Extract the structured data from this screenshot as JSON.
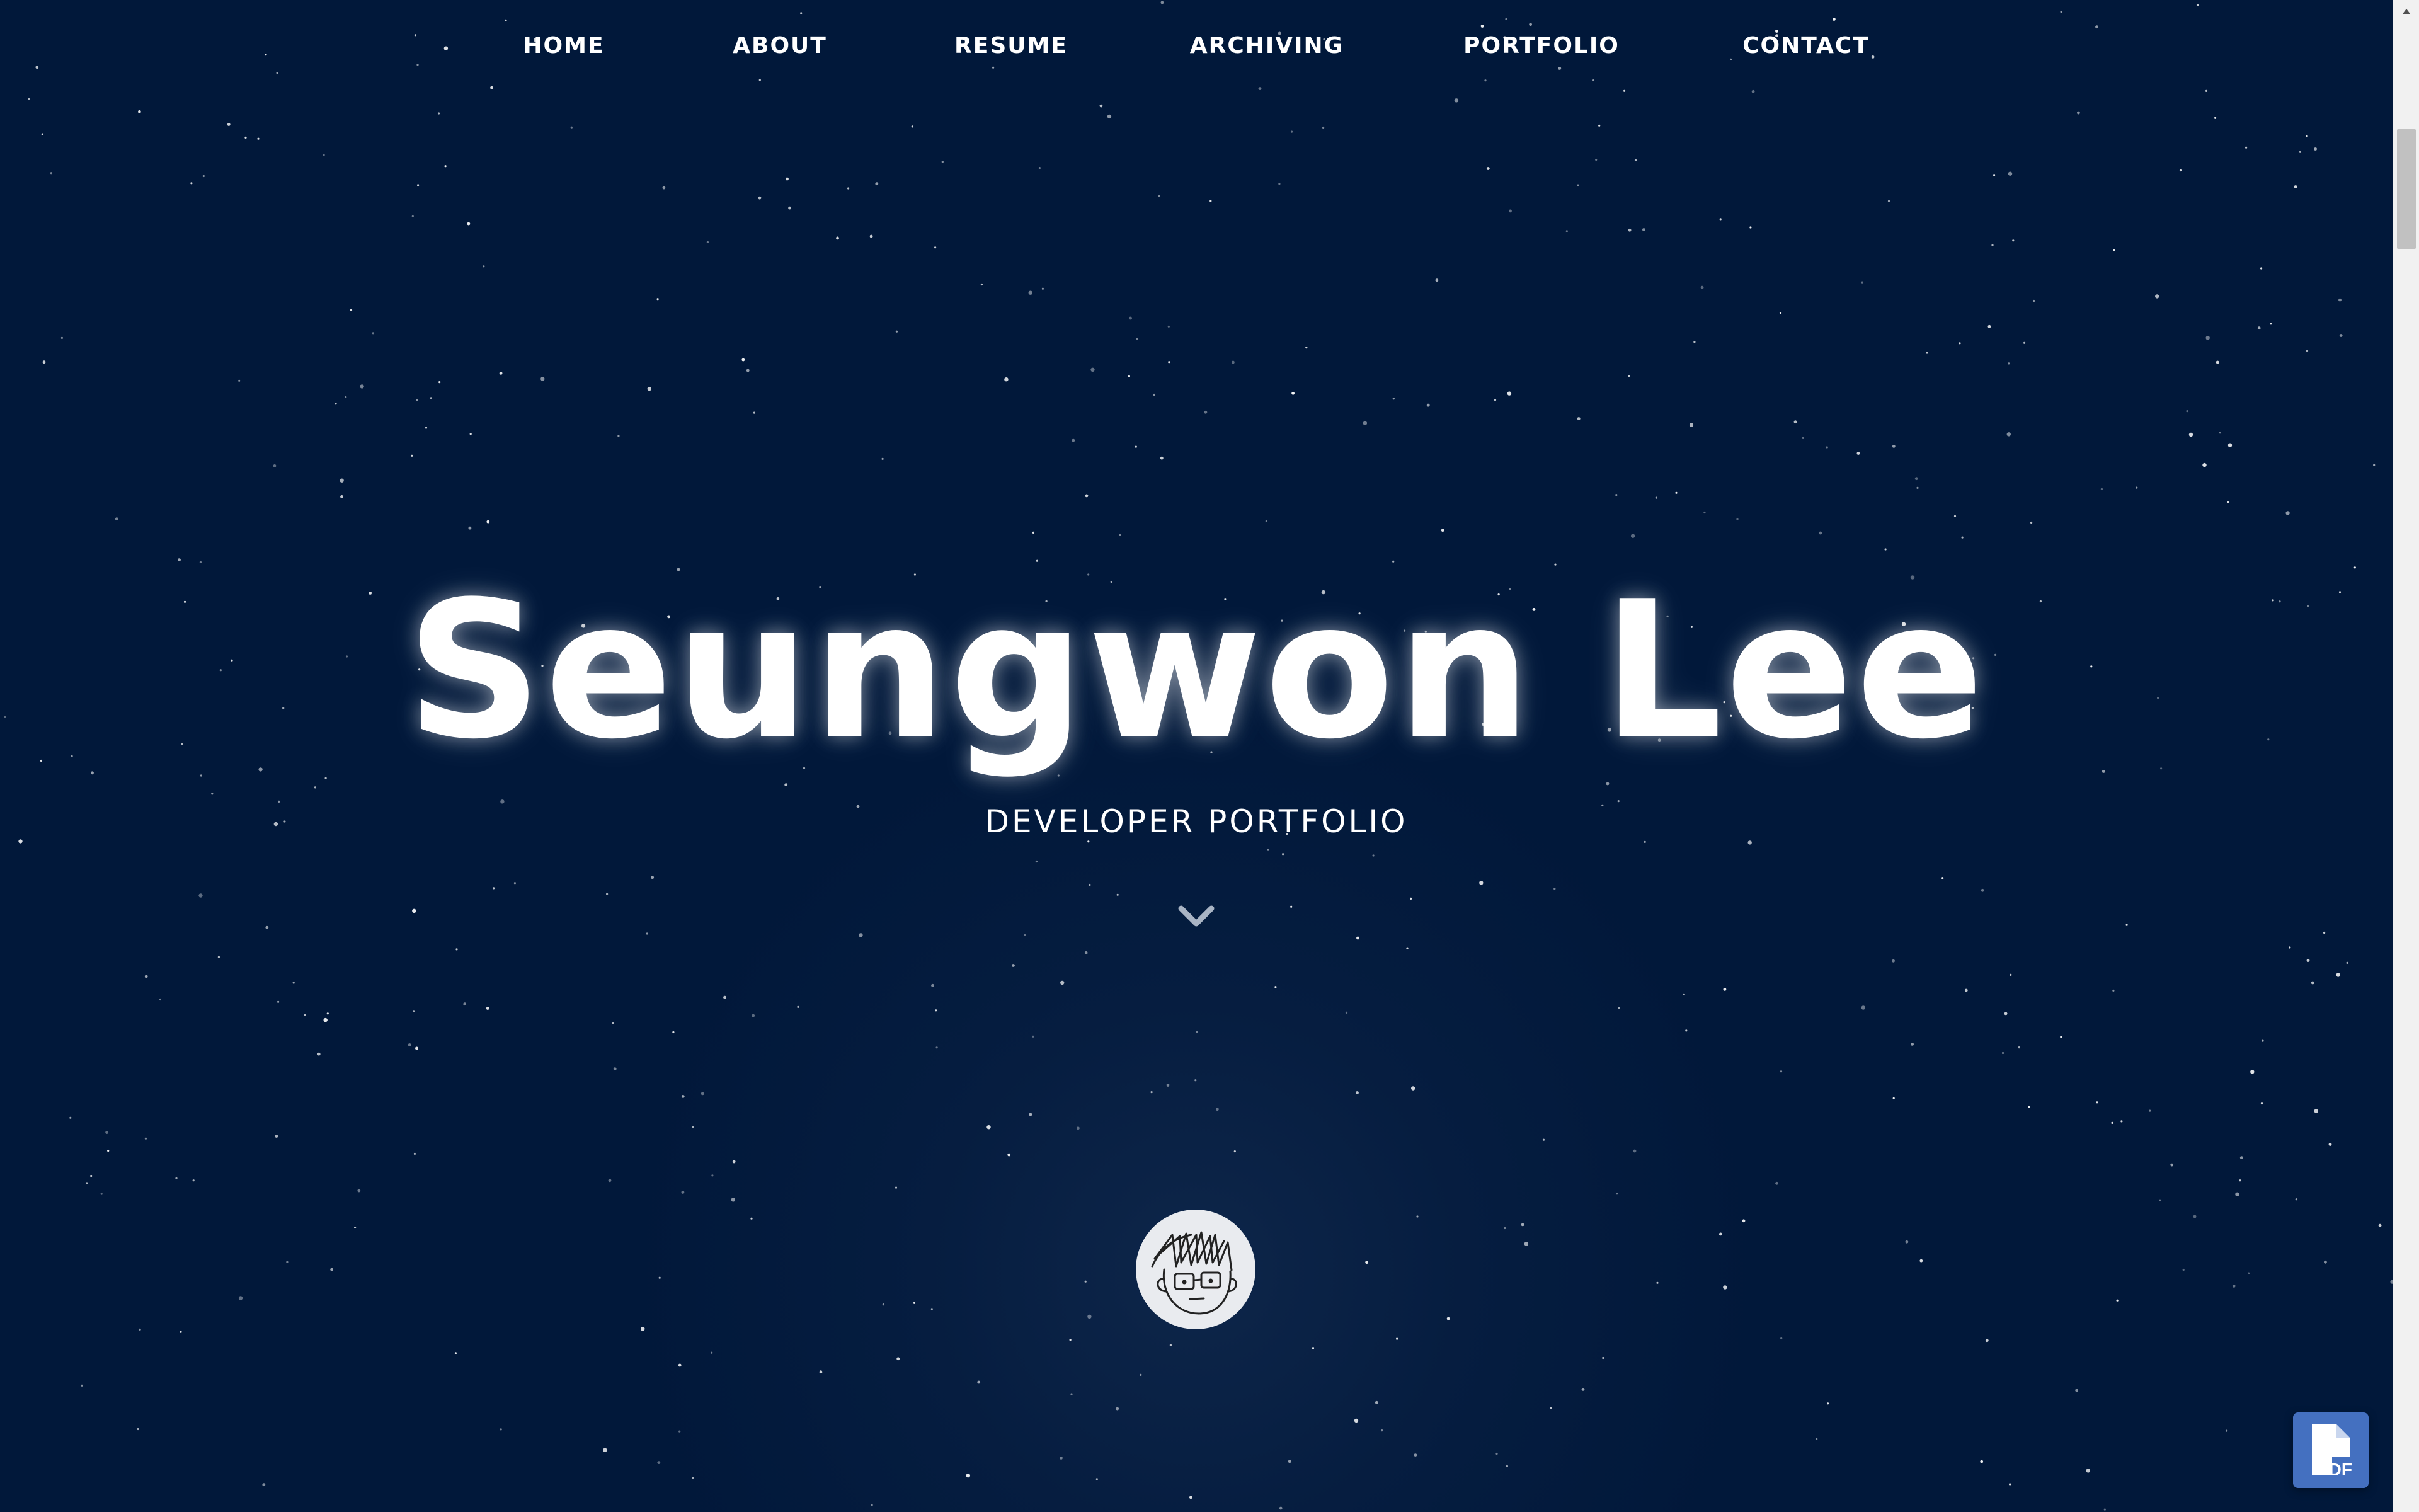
{
  "nav": {
    "items": [
      {
        "label": "HOME"
      },
      {
        "label": "ABOUT"
      },
      {
        "label": "RESUME"
      },
      {
        "label": "ARCHIVING"
      },
      {
        "label": "PORTFOLIO"
      },
      {
        "label": "CONTACT"
      }
    ]
  },
  "hero": {
    "title": "Seungwon Lee",
    "subtitle": "DEVELOPER PORTFOLIO",
    "scroll_icon": "chevron-down-icon",
    "avatar_icon": "avatar-sketch-icon"
  },
  "floating": {
    "pdf_icon": "pdf-file-icon",
    "pdf_text": "PDF"
  },
  "colors": {
    "background": "#01183a",
    "text": "#ffffff",
    "pdf_button": "#4470c0"
  }
}
